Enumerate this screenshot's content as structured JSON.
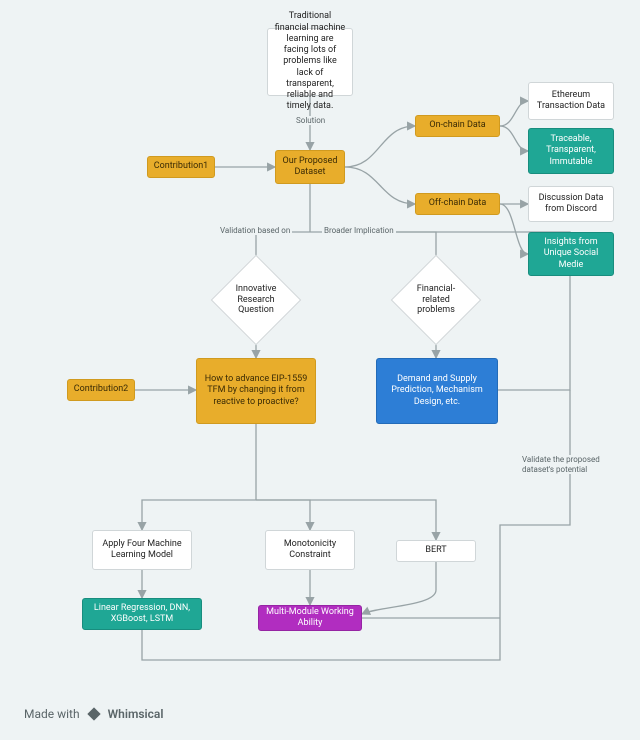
{
  "nodes": {
    "intro": "Traditional financial machine learning are facing lots of problems like lack of transparent, reliable and timely data.",
    "contribution1": "Contribution1",
    "proposed": "Our Proposed Dataset",
    "onchain": "On-chain Data",
    "offchain": "Off-chain Data",
    "eth_tx": "Ethereum Transaction Data",
    "traceable": "Traceable, Transparent, Immutable",
    "discord": "Discussion Data from Discord",
    "insights": "Insights from Unique Social Medie",
    "irq": "Innovative Research Question",
    "frp": "Financial-related problems",
    "contribution2": "Contribution2",
    "eip": "How to advance EIP-1559 TFM by changing it from reactive to proactive?",
    "demand": "Demand and Supply Prediction, Mechanism Design, etc.",
    "apply4": "Apply Four Machine Learning Model",
    "models": "Linear Regression, DNN, XGBoost, LSTM",
    "mono": "Monotonicity Constraint",
    "bert": "BERT",
    "mmwa": "Multi-Module Working Ability"
  },
  "edge_labels": {
    "solution": "Solution",
    "validation": "Validation based on",
    "broader": "Broader Implication",
    "validate_potential": "Validate the proposed dataset's potential"
  },
  "footer": {
    "made_with": "Made with",
    "brand": "Whimsical"
  },
  "colors": {
    "bg": "#eef3f4",
    "yellow": "#e8ad2b",
    "teal": "#1fa795",
    "blue": "#2d7ed6",
    "purple": "#b12dc0",
    "edge": "#98a3a6"
  }
}
